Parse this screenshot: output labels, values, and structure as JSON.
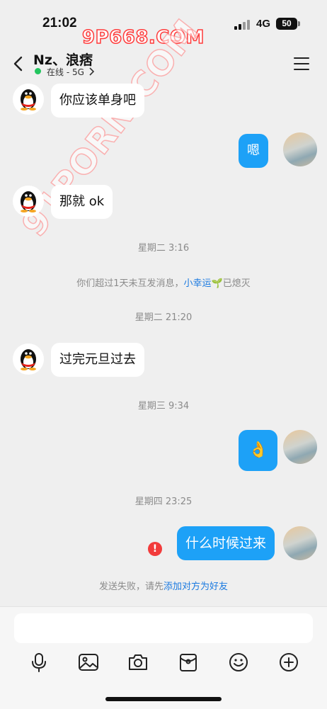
{
  "status_bar": {
    "time": "21:02",
    "network": "4G",
    "battery": "50"
  },
  "watermarks": {
    "top": "9P668.COM",
    "diagonal": "91PORN.COM"
  },
  "header": {
    "contact_name": "Nz、浪痞",
    "online_status": "在线 - 5G"
  },
  "messages": [
    {
      "side": "left",
      "text": "你应该单身吧"
    },
    {
      "side": "right",
      "text": "嗯"
    },
    {
      "side": "left",
      "text": "那就 ok"
    },
    {
      "side": "time",
      "text": "星期二 3:16"
    },
    {
      "side": "system",
      "text_before": "你们超过1天未互发消息，",
      "link": "小幸运",
      "emoji": "🌱",
      "text_after": "已熄灭"
    },
    {
      "side": "time",
      "text": "星期二 21:20"
    },
    {
      "side": "left",
      "text": "过完元旦过去"
    },
    {
      "side": "time",
      "text": "星期三 9:34"
    },
    {
      "side": "right",
      "text": "👌"
    },
    {
      "side": "time",
      "text": "星期四 23:25"
    },
    {
      "side": "right",
      "text": "什么时候过来",
      "failed": true,
      "error_mark": "!"
    },
    {
      "side": "system",
      "text_before": "发送失败，请先",
      "link": "添加对方为好友"
    }
  ],
  "input": {
    "placeholder": ""
  },
  "toolbar": [
    "microphone-icon",
    "image-icon",
    "camera-icon",
    "red-packet-icon",
    "emoji-icon",
    "plus-icon"
  ],
  "colors": {
    "bubble_blue": "#1da1f7",
    "link_blue": "#1b7ae0",
    "online_green": "#22c55e",
    "error_red": "#f23b3b"
  }
}
